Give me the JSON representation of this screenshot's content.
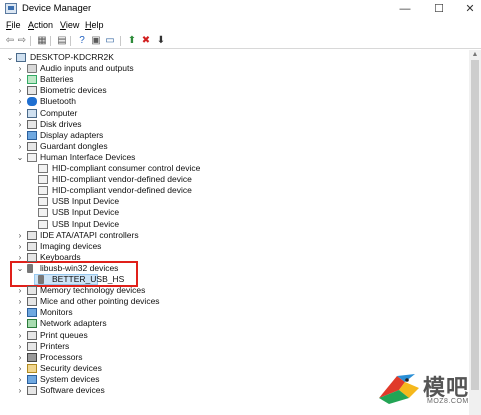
{
  "window": {
    "title": "Device Manager",
    "min_glyph": "—",
    "max_glyph": "☐",
    "close_glyph": "✕"
  },
  "menu": [
    {
      "pre": "",
      "key": "F",
      "post": "ile"
    },
    {
      "pre": "",
      "key": "A",
      "post": "ction"
    },
    {
      "pre": "",
      "key": "V",
      "post": "iew"
    },
    {
      "pre": "",
      "key": "H",
      "post": "elp"
    }
  ],
  "toolbar": [
    {
      "name": "back-icon",
      "glyph": "⇦",
      "color": "#6b6b6b"
    },
    {
      "name": "forward-icon",
      "glyph": "⇨",
      "color": "#6b6b6b"
    },
    {
      "name": "properties-grid-icon",
      "glyph": "▦",
      "color": "#5a5a5a"
    },
    {
      "name": "properties-sheet-icon",
      "glyph": "▤",
      "color": "#5a5a5a"
    },
    {
      "name": "help-icon",
      "glyph": "?",
      "color": "#1f5fbf"
    },
    {
      "name": "action-pane-icon",
      "glyph": "▣",
      "color": "#5a5a5a"
    },
    {
      "name": "display-icon",
      "glyph": "▭",
      "color": "#2b5f9c"
    },
    {
      "name": "update-driver-icon",
      "glyph": "⬆",
      "color": "#2e8b3a"
    },
    {
      "name": "disable-device-icon",
      "glyph": "✖",
      "color": "#d22020"
    },
    {
      "name": "scan-hardware-icon",
      "glyph": "⬇",
      "color": "#333333"
    }
  ],
  "tree": {
    "root": "DESKTOP-KDCRR2K",
    "items": [
      {
        "label": "Audio inputs and outputs",
        "level": 1,
        "state": "collapsed",
        "icon": "audio-icon"
      },
      {
        "label": "Batteries",
        "level": 1,
        "state": "collapsed",
        "icon": "battery-icon"
      },
      {
        "label": "Biometric devices",
        "level": 1,
        "state": "collapsed",
        "icon": "biometric-icon"
      },
      {
        "label": "Bluetooth",
        "level": 1,
        "state": "collapsed",
        "icon": "bluetooth-icon"
      },
      {
        "label": "Computer",
        "level": 1,
        "state": "collapsed",
        "icon": "computer-icon"
      },
      {
        "label": "Disk drives",
        "level": 1,
        "state": "collapsed",
        "icon": "disk-icon"
      },
      {
        "label": "Display adapters",
        "level": 1,
        "state": "collapsed",
        "icon": "display-adapter-icon"
      },
      {
        "label": "Guardant dongles",
        "level": 1,
        "state": "collapsed",
        "icon": "dongle-icon"
      },
      {
        "label": "Human Interface Devices",
        "level": 1,
        "state": "expanded",
        "icon": "hid-icon"
      },
      {
        "label": "HID-compliant consumer control device",
        "level": 2,
        "state": "leaf",
        "icon": "hid-device-icon"
      },
      {
        "label": "HID-compliant vendor-defined device",
        "level": 2,
        "state": "leaf",
        "icon": "hid-device-icon"
      },
      {
        "label": "HID-compliant vendor-defined device",
        "level": 2,
        "state": "leaf",
        "icon": "hid-device-icon"
      },
      {
        "label": "USB Input Device",
        "level": 2,
        "state": "leaf",
        "icon": "hid-device-icon"
      },
      {
        "label": "USB Input Device",
        "level": 2,
        "state": "leaf",
        "icon": "hid-device-icon"
      },
      {
        "label": "USB Input Device",
        "level": 2,
        "state": "leaf",
        "icon": "hid-device-icon"
      },
      {
        "label": "IDE ATA/ATAPI controllers",
        "level": 1,
        "state": "collapsed",
        "icon": "ide-icon"
      },
      {
        "label": "Imaging devices",
        "level": 1,
        "state": "collapsed",
        "icon": "imaging-icon"
      },
      {
        "label": "Keyboards",
        "level": 1,
        "state": "collapsed",
        "icon": "keyboard-icon"
      },
      {
        "label": "libusb-win32 devices",
        "level": 1,
        "state": "expanded",
        "icon": "usb-icon"
      },
      {
        "label": "BETTER_USB_HS",
        "level": 2,
        "state": "leaf",
        "icon": "usb-device-icon",
        "selected": true
      },
      {
        "label": "Memory technology devices",
        "level": 1,
        "state": "collapsed",
        "icon": "memory-icon"
      },
      {
        "label": "Mice and other pointing devices",
        "level": 1,
        "state": "collapsed",
        "icon": "mouse-icon"
      },
      {
        "label": "Monitors",
        "level": 1,
        "state": "collapsed",
        "icon": "monitor-icon"
      },
      {
        "label": "Network adapters",
        "level": 1,
        "state": "collapsed",
        "icon": "network-icon"
      },
      {
        "label": "Print queues",
        "level": 1,
        "state": "collapsed",
        "icon": "printer-queue-icon"
      },
      {
        "label": "Printers",
        "level": 1,
        "state": "collapsed",
        "icon": "printer-icon"
      },
      {
        "label": "Processors",
        "level": 1,
        "state": "collapsed",
        "icon": "processor-icon"
      },
      {
        "label": "Security devices",
        "level": 1,
        "state": "collapsed",
        "icon": "security-icon"
      },
      {
        "label": "System devices",
        "level": 1,
        "state": "collapsed",
        "icon": "system-icon"
      },
      {
        "label": "Software devices",
        "level": 1,
        "state": "collapsed",
        "icon": "software-icon"
      }
    ]
  },
  "watermark": {
    "text": "模吧",
    "url": "MOZ8.COM"
  },
  "colors": {
    "highlight_box": "#e0201a",
    "selection": "#cce4f7"
  }
}
